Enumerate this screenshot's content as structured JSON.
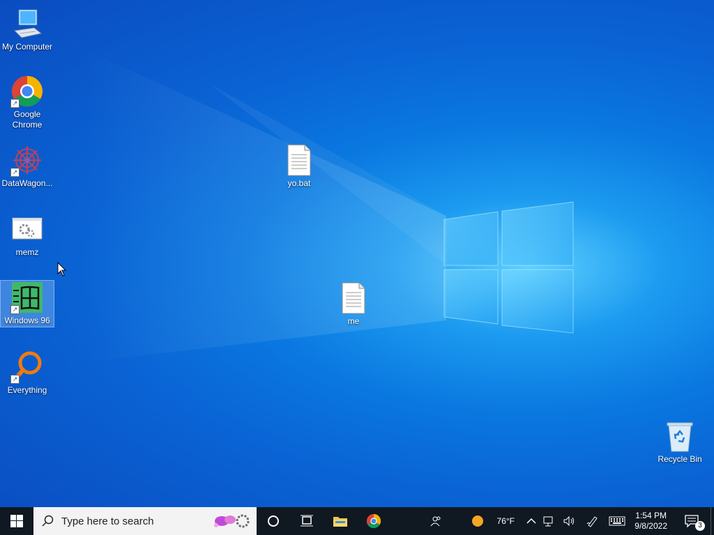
{
  "desktop": {
    "icons": [
      {
        "label": "My Computer",
        "icon": "computer-icon"
      },
      {
        "label": "Google Chrome",
        "icon": "chrome-icon"
      },
      {
        "label": "DataWagon...",
        "icon": "datawagon-icon"
      },
      {
        "label": "memz",
        "icon": "gears-window-icon"
      },
      {
        "label": "Windows 96",
        "icon": "windows96-icon"
      },
      {
        "label": "Everything",
        "icon": "everything-search-icon"
      },
      {
        "label": "yo.bat",
        "icon": "text-file-icon"
      },
      {
        "label": "me",
        "icon": "text-file-icon"
      },
      {
        "label": "Recycle Bin",
        "icon": "recycle-bin-icon"
      }
    ]
  },
  "taskbar": {
    "search_placeholder": "Type here to search",
    "weather_temp": "76°F",
    "time": "1:54 PM",
    "date": "9/8/2022",
    "notification_count": "3",
    "pinned": [
      "cortana-icon",
      "task-view-icon",
      "file-explorer-icon",
      "chrome-icon"
    ]
  },
  "colors": {
    "taskbar_bg": "#101822",
    "desktop_blue": "#0a78e0",
    "search_bg": "#f3f3f3"
  }
}
